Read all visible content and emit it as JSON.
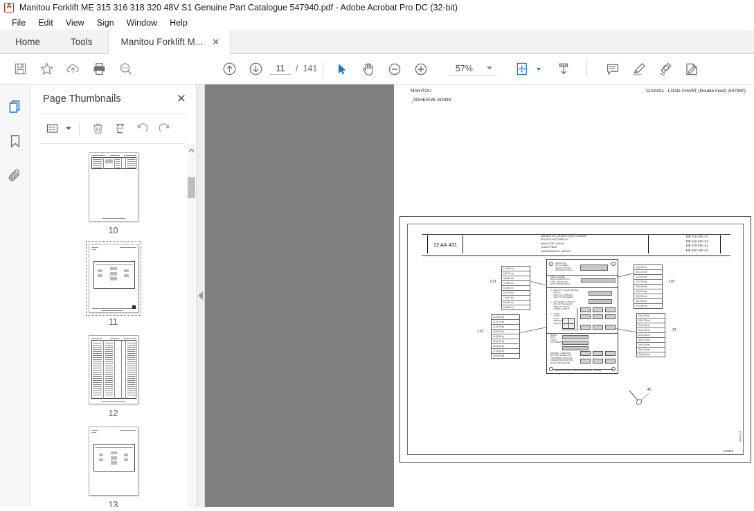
{
  "window": {
    "title": "Manitou Forklift ME 315 316 318 320 48V S1 Genuine Part Catalogue 547940.pdf - Adobe Acrobat Pro DC (32-bit)",
    "app_icon": "acrobat-icon"
  },
  "menubar": {
    "items": [
      {
        "label": "File"
      },
      {
        "label": "Edit"
      },
      {
        "label": "View"
      },
      {
        "label": "Sign"
      },
      {
        "label": "Window"
      },
      {
        "label": "Help"
      }
    ]
  },
  "tabs": {
    "home": "Home",
    "tools": "Tools",
    "document": "Manitou Forklift M...",
    "close_glyph": "✕"
  },
  "toolbar": {
    "left_icons": [
      {
        "name": "save-icon",
        "title": "Save"
      },
      {
        "name": "star-icon",
        "title": "Add to favorites"
      },
      {
        "name": "cloud-upload-icon",
        "title": "Upload to cloud"
      },
      {
        "name": "print-icon",
        "title": "Print"
      },
      {
        "name": "search-zoom-icon",
        "title": "Find"
      }
    ],
    "nav": {
      "prev_icon": "arrow-up-circle-icon",
      "next_icon": "arrow-down-circle-icon",
      "page_current": "11",
      "page_separator": "/",
      "page_total": "141"
    },
    "tools": [
      {
        "name": "select-cursor-icon",
        "title": "Select tool",
        "accent": true
      },
      {
        "name": "hand-tool-icon",
        "title": "Hand tool"
      },
      {
        "name": "zoom-out-icon",
        "title": "Zoom out"
      },
      {
        "name": "zoom-in-icon",
        "title": "Zoom in"
      }
    ],
    "zoom_value": "57%",
    "fit_icon": "fit-page-icon",
    "scroll_mode_icon": "page-down-icon",
    "right_icons": [
      {
        "name": "comment-icon",
        "title": "Add comment"
      },
      {
        "name": "highlight-icon",
        "title": "Highlight text"
      },
      {
        "name": "draw-icon",
        "title": "Draw free form"
      },
      {
        "name": "sign-icon",
        "title": "Fill & Sign"
      }
    ]
  },
  "rail": {
    "items": [
      {
        "name": "page-thumbnails-icon",
        "label": "Page Thumbnails",
        "active": true
      },
      {
        "name": "bookmarks-icon",
        "label": "Bookmarks",
        "active": false
      },
      {
        "name": "attachments-icon",
        "label": "Attachments",
        "active": false
      }
    ]
  },
  "thumbnails_panel": {
    "title": "Page Thumbnails",
    "close_glyph": "✕",
    "tools": [
      {
        "name": "page-options-icon",
        "title": "Options"
      },
      {
        "name": "delete-pages-icon",
        "title": "Delete pages"
      },
      {
        "name": "extract-pages-icon",
        "title": "Extract pages"
      },
      {
        "name": "rotate-ccw-icon",
        "title": "Rotate counterclockwise"
      },
      {
        "name": "rotate-cw-icon",
        "title": "Rotate clockwise"
      }
    ],
    "pages": [
      {
        "number": "10",
        "selected": false,
        "kind": "table-top"
      },
      {
        "number": "11",
        "selected": true,
        "kind": "drawing"
      },
      {
        "number": "12",
        "selected": false,
        "kind": "table-full"
      },
      {
        "number": "13",
        "selected": false,
        "kind": "drawing"
      }
    ],
    "scroll_up_glyph": "︿"
  },
  "collapse_handle": {
    "name": "collapse-panel-handle",
    "glyph": "◀"
  },
  "document": {
    "header_left": "MANITOU",
    "header_right": "12AA431 - LOAD CHART (Double mast) (547940)",
    "header_sub": "_ADHESIVE SIGNS",
    "drawing": {
      "code": "12 AA 431",
      "languages": [
        "ABAQUE DE CHARGE (MAT DOUBLE)",
        "BELASTUNG TABELLE",
        "ABACO DE CARGA",
        "LOAD CHART",
        "DIAGRAMMA DI CARICO"
      ],
      "models": [
        "ME 315 48V  S1",
        "ME 316 48V  S1",
        "ME 318 48V  S1",
        "ME 320 48V  S1"
      ],
      "callouts": [
        {
          "label": "1.5T",
          "position": "top-left",
          "rows": [
            "1   (2.50 m)",
            "2   (2.75 m)",
            "3   (3.00 m)",
            "4   (3.30 m)",
            "5   (3.50 m)",
            "6   (3.70 m)",
            "7   (4.00 m)",
            "8   (4.30 m)",
            "9   (4.50 m)"
          ]
        },
        {
          "label": "1.6T",
          "position": "bottom-left",
          "rows": [
            "10  (2.50 m)",
            "11  (2.75 m)",
            "12  (3.00 m)",
            "13  (3.30 m)",
            "14  (3.50 m)",
            "15  (3.70 m)",
            "16  (4.00 m)",
            "17  (4.30 m)",
            "18  (4.50 m)"
          ]
        },
        {
          "label": "1.8T",
          "position": "top-right",
          "rows": [
            "19  (2.50 m)",
            "20  (2.75 m)",
            "21  (3.00 m)",
            "22  (3.30 m)",
            "23  (3.50 m)",
            "24  (3.70 m)",
            "25  (4.00 m)",
            "26  (4.30 m)",
            "27  (4.50 m)"
          ]
        },
        {
          "label": "2T",
          "position": "bottom-right",
          "rows": [
            "28  (2.50 m)",
            "29  (2.75 m)",
            "30  (3.00 m)",
            "31  (3.30 m)",
            "32  (3.50 m)",
            "33  (3.70 m)",
            "34  (4.00 m)",
            "35  (4.30 m)",
            "36  (4.50 m)"
          ]
        }
      ],
      "marker_callout_number": "40",
      "footer_number": "547940",
      "side_number": "52713000"
    }
  }
}
